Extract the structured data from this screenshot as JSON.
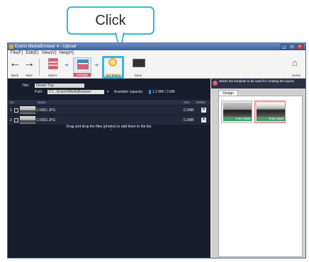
{
  "callout": {
    "label": "Click"
  },
  "window": {
    "title": "Everio MediaBrowser 4 - Upload",
    "menu": [
      "File(F)",
      "Edit(E)",
      "View(V)",
      "Help(H)"
    ],
    "toolbar": {
      "back_label": "Back",
      "next_label": "Next",
      "select_label": "Select",
      "arrange_label": "Arrange",
      "set_button_label": "Set Button",
      "save_label": "Save",
      "home_label": "Home"
    },
    "fields": {
      "title_label": "Title:",
      "title_value": "Flower Trip",
      "path_label": "Path:",
      "path_value": "C:\\...\\Everio\\MediaBrowser",
      "available_label": "Available capacity:",
      "available_value": "1.2 MB / 3 MB"
    },
    "list": {
      "headers": [
        "No",
        "",
        "Name",
        "Size",
        "Delete"
      ],
      "rows": [
        {
          "no": "1",
          "name": "C:0001.JPG",
          "size": "0.2MB",
          "delete": "✕"
        },
        {
          "no": "2",
          "name": "C:0002.JPG",
          "size": "0.2MB",
          "delete": "✕"
        }
      ],
      "notice": "Drag and drop the files (photos) to add them to the list."
    },
    "right_panel": {
      "info": "!",
      "message": "Select the template to be used for creating the layout.",
      "tab": "Design",
      "cards": [
        {
          "label": "Free Style"
        },
        {
          "label": "Free Style"
        }
      ]
    }
  },
  "colors": {
    "accent": "#35b8d8",
    "list_bg": "#181c2c",
    "card_selected": "#f2c6c6"
  }
}
